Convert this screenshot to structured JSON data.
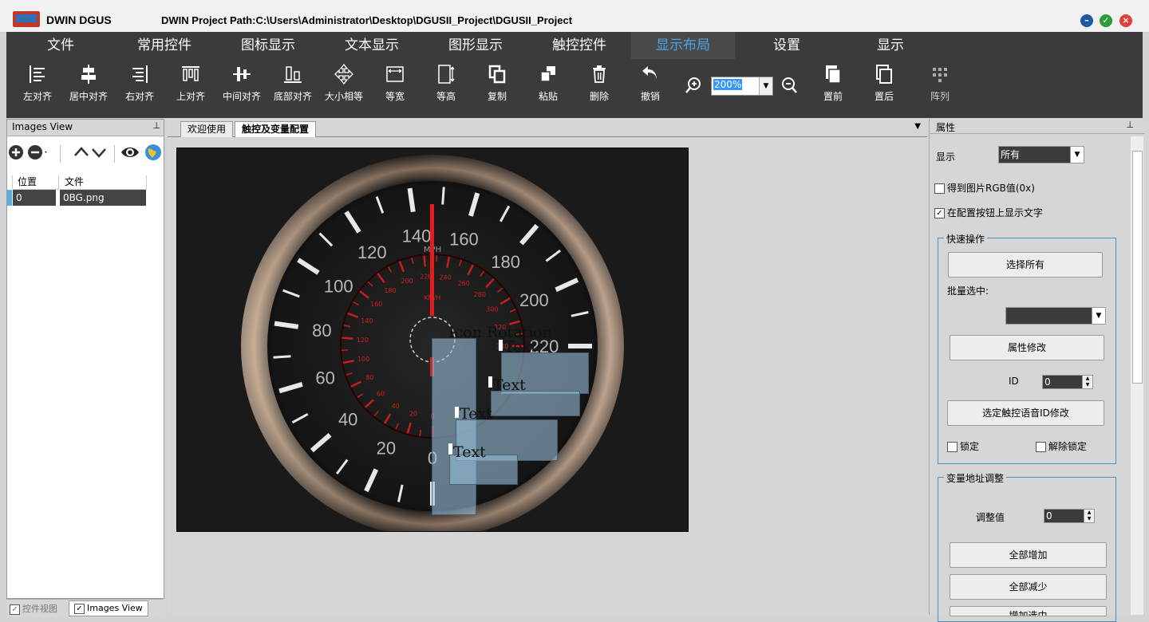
{
  "window": {
    "app_name": "DWIN DGUS",
    "project_path": "DWIN Project Path:C:\\Users\\Administrator\\Desktop\\DGUSII_Project\\DGUSII_Project",
    "buttons": [
      "–",
      "✓",
      "×"
    ]
  },
  "menu": {
    "items": [
      "文件",
      "常用控件",
      "图标显示",
      "文本显示",
      "图形显示",
      "触控控件",
      "显示布局",
      "设置",
      "显示"
    ],
    "active_index": 6,
    "active_color": "#4aa3e6"
  },
  "toolbar": {
    "buttons": [
      "左对齐",
      "居中对齐",
      "右对齐",
      "上对齐",
      "中间对齐",
      "底部对齐",
      "大小相等",
      "等宽",
      "等高",
      "复制",
      "粘贴",
      "删除",
      "撤销"
    ],
    "zoom_value": "200%",
    "right_buttons": [
      "置前",
      "置后",
      "阵列"
    ]
  },
  "left_panel": {
    "title": "Images View",
    "pin": "⊥",
    "columns": [
      "位置",
      "文件"
    ],
    "rows": [
      [
        "0",
        "0BG.png"
      ]
    ],
    "bottom_tabs": [
      "控件视图",
      "Images View"
    ]
  },
  "center": {
    "tabs": [
      "欢迎使用",
      "触控及变量配置"
    ],
    "active_tab": 1,
    "canvas": {
      "background_image": "speedometer-gauge",
      "labels": [
        "Icon Rotation",
        "Text",
        "Text",
        "Text",
        "Text"
      ]
    },
    "gauge": {
      "mph_labels": [
        "0",
        "20",
        "40",
        "60",
        "80",
        "100",
        "120",
        "140",
        "160",
        "180",
        "200",
        "220"
      ],
      "kmh_labels": [
        "0",
        "20",
        "40",
        "60",
        "80",
        "100",
        "120",
        "140",
        "160",
        "180",
        "200",
        "220",
        "240",
        "260",
        "280",
        "300",
        "320",
        "340"
      ],
      "mph_unit": "MPH",
      "kmh_unit": "KM/H"
    }
  },
  "right_panel": {
    "title": "属性",
    "display_label": "显示",
    "display_value": "所有",
    "chk_rgb": "得到图片RGB值(0x)",
    "chk_show_text": "在配置按钮上显示文字",
    "group_quick": "快速操作",
    "btn_select_all": "选择所有",
    "batch_label": "批量选中:",
    "btn_attr_modify": "属性修改",
    "id_label": "ID",
    "id_value": "0",
    "btn_voice_id": "选定触控语音ID修改",
    "lock_label": "锁定",
    "unlock_label": "解除锁定",
    "group_var": "变量地址调整",
    "adjust_label": "调整值",
    "adjust_value": "0",
    "btn_inc_all": "全部增加",
    "btn_dec_all": "全部减少",
    "btn_partial": "增加选中"
  }
}
